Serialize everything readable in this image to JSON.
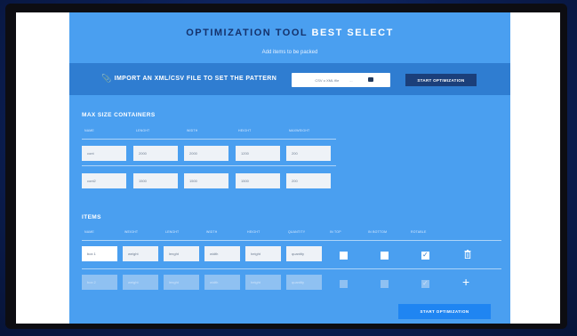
{
  "header": {
    "title_part1": "OPTIMIZATION TOOL",
    "title_part2": "BEST SELECT",
    "subtitle": "Add items to be packed"
  },
  "import": {
    "label": "IMPORT AN XML/CSV FILE TO SET THE PATTERN",
    "file_placeholder": "CSV o XML file",
    "file_suffix": "...",
    "button": "START OPTIMIZATION"
  },
  "containers": {
    "title": "MAX SIZE CONTAINERS",
    "columns": [
      "NAME",
      "LENGHT",
      "WIDTH",
      "HEIGHT",
      "MAXWEIGHT"
    ],
    "rows": [
      [
        "cont",
        "2000",
        "2000",
        "1200",
        "200"
      ],
      [
        "cont2",
        "1500",
        "1500",
        "1500",
        "200"
      ]
    ]
  },
  "items": {
    "title": "ITEMS",
    "columns": [
      "NAME",
      "WEIGHT",
      "LENGHT",
      "WIDTH",
      "HEIGHT",
      "QUANTITY",
      "IN TOP",
      "IN BOTTOM",
      "ROTABLE"
    ],
    "rows": [
      {
        "values": [
          "box 1",
          "weight",
          "lenght",
          "width",
          "height",
          "quantity"
        ],
        "in_top": false,
        "in_bottom": false,
        "rotable": true
      },
      {
        "values": [
          "box 2",
          "weight",
          "lenght",
          "width",
          "height",
          "quantity"
        ],
        "in_top": false,
        "in_bottom": false,
        "rotable": true
      }
    ],
    "check_glyph": "✓",
    "plus_glyph": "+",
    "icons": {
      "row1_action": "trash-icon",
      "row2_action": "plus-icon"
    }
  },
  "footer": {
    "button": "START OPTIMIZATION"
  },
  "colors": {
    "panel": "#4a9ff0",
    "import_bar": "#2f7dd1",
    "dark_button": "#1b3f7a",
    "bottom_button": "#1f85f2",
    "title_dark": "#15326b"
  }
}
